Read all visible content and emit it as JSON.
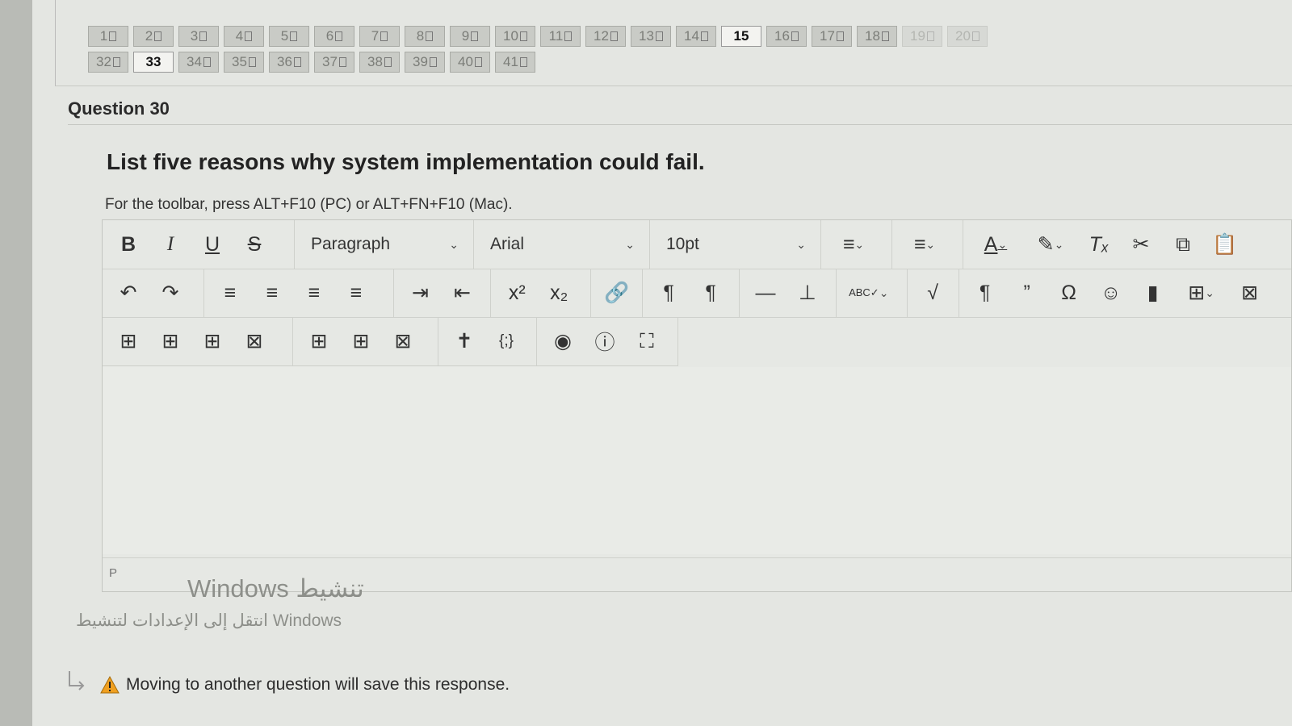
{
  "question_nav": {
    "row1": [
      {
        "label": "1",
        "current": false
      },
      {
        "label": "2",
        "current": false
      },
      {
        "label": "3",
        "current": false
      },
      {
        "label": "4",
        "current": false
      },
      {
        "label": "5",
        "current": false
      },
      {
        "label": "6",
        "current": false
      },
      {
        "label": "7",
        "current": false
      },
      {
        "label": "8",
        "current": false
      },
      {
        "label": "9",
        "current": false
      },
      {
        "label": "10",
        "current": false
      },
      {
        "label": "11",
        "current": false
      },
      {
        "label": "12",
        "current": false
      },
      {
        "label": "13",
        "current": false
      },
      {
        "label": "14",
        "current": false
      },
      {
        "label": "15",
        "current": true
      },
      {
        "label": "16",
        "current": false
      },
      {
        "label": "17",
        "current": false
      },
      {
        "label": "18",
        "current": false
      },
      {
        "label": "19",
        "current": false
      },
      {
        "label": "20",
        "current": false
      }
    ],
    "row2": [
      {
        "label": "32",
        "current": false
      },
      {
        "label": "33",
        "current": true
      },
      {
        "label": "34",
        "current": false
      },
      {
        "label": "35",
        "current": false
      },
      {
        "label": "36",
        "current": false
      },
      {
        "label": "37",
        "current": false
      },
      {
        "label": "38",
        "current": false
      },
      {
        "label": "39",
        "current": false
      },
      {
        "label": "40",
        "current": false
      },
      {
        "label": "41",
        "current": false
      }
    ]
  },
  "question": {
    "title": "Question 30",
    "text": "List five reasons why system implementation could fail."
  },
  "editor": {
    "toolbar_hint": "For the toolbar, press ALT+F10 (PC) or ALT+FN+F10 (Mac).",
    "block_format": "Paragraph",
    "font_family": "Arial",
    "font_size": "10pt",
    "status_path": "P",
    "content": ""
  },
  "watermark": {
    "line1": "Windows تنشيط",
    "line2": "انتقل إلى الإعدادات لتنشيط Windows"
  },
  "footer": {
    "save_note": "Moving to another question will save this response."
  }
}
